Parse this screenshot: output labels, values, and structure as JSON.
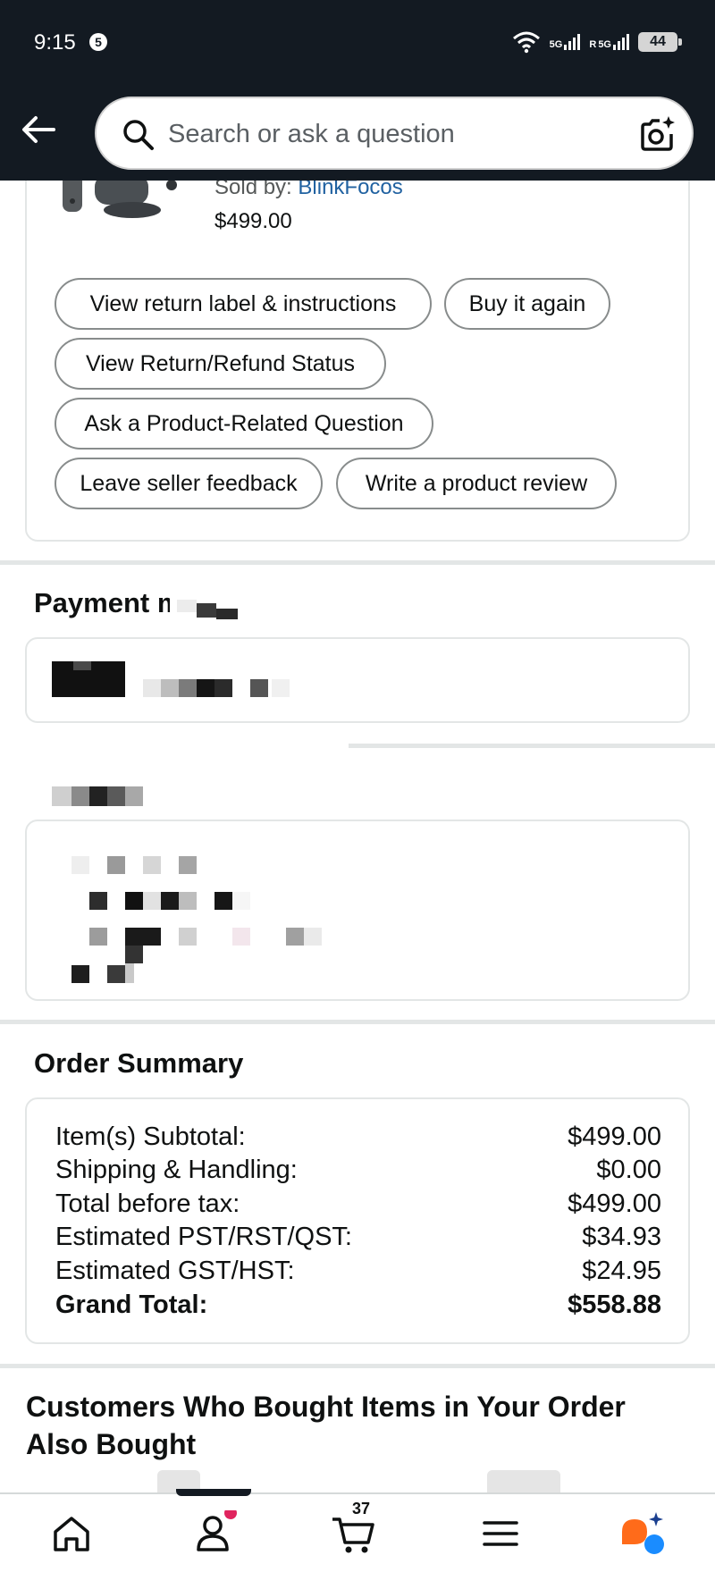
{
  "status_bar": {
    "time": "9:15",
    "notification_count": "5",
    "network_1": "5G",
    "network_2": "5G",
    "roaming": "R",
    "battery": "44"
  },
  "header": {
    "search_placeholder": "Search or ask a question",
    "icons": [
      "back-arrow-icon",
      "search-icon",
      "camera-search-icon"
    ]
  },
  "order_item": {
    "sold_by_label": "Sold by: ",
    "seller": "BlinkFocos",
    "price": "$499.00",
    "actions": [
      "View return label & instructions",
      "Buy it again",
      "View Return/Refund Status",
      "Ask a Product-Related Question",
      "Leave seller feedback",
      "Write a product review"
    ]
  },
  "payment": {
    "title": "Payment method"
  },
  "order_summary": {
    "title": "Order Summary",
    "rows": [
      {
        "label": "Item(s) Subtotal:",
        "value": "$499.00"
      },
      {
        "label": "Shipping & Handling:",
        "value": "$0.00"
      },
      {
        "label": "Total before tax:",
        "value": "$499.00"
      },
      {
        "label": "Estimated PST/RST/QST:",
        "value": "$34.93"
      },
      {
        "label": "Estimated GST/HST:",
        "value": "$24.95"
      },
      {
        "label": "Grand Total:",
        "value": "$558.88"
      }
    ]
  },
  "recommendations": {
    "title": "Customers Who Bought Items in Your Order Also Bought"
  },
  "bottom_nav": {
    "items": [
      "home-icon",
      "account-icon",
      "cart-icon",
      "menu-icon",
      "rufus-assistant-icon"
    ],
    "cart_count": "37",
    "colors": {
      "account_dot": "#e0245e",
      "rufus_orange": "#ff6b1a",
      "rufus_blue": "#1a8cff"
    }
  }
}
